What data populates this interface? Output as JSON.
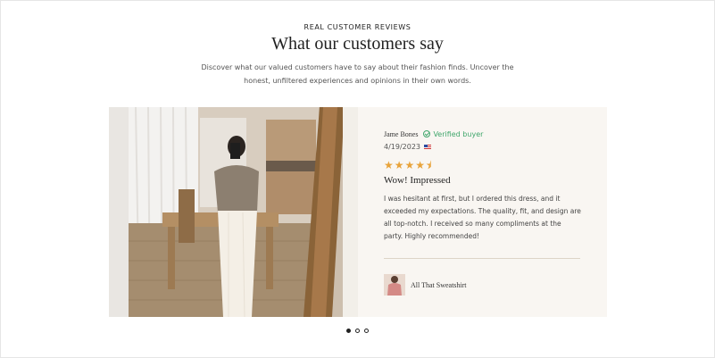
{
  "section": {
    "eyebrow": "REAL CUSTOMER REVIEWS",
    "title": "What our customers say",
    "subtitle": "Discover what our valued customers have to say about their fashion finds. Uncover the honest, unfiltered experiences and opinions in their own words."
  },
  "review": {
    "reviewer": "Jame Bones",
    "verified_label": "Verified buyer",
    "date": "4/19/2023",
    "rating": 4.5,
    "stars_display": "★★★★⯨",
    "title": "Wow! Impressed",
    "body": "I was hesitant at first, but I ordered this dress, and it exceeded my expectations. The quality, fit, and design are all top-notch. I received so many compliments at the party. Highly recommended!",
    "product_name": "All That Sweatshirt"
  },
  "carousel": {
    "slide_count": 3,
    "active_index": 0
  },
  "colors": {
    "verified": "#3fa66b",
    "star": "#e8a33a",
    "card_bg": "#f9f6f2"
  },
  "icons": [
    "check-circle-icon",
    "us-flag-icon",
    "star-icon"
  ]
}
